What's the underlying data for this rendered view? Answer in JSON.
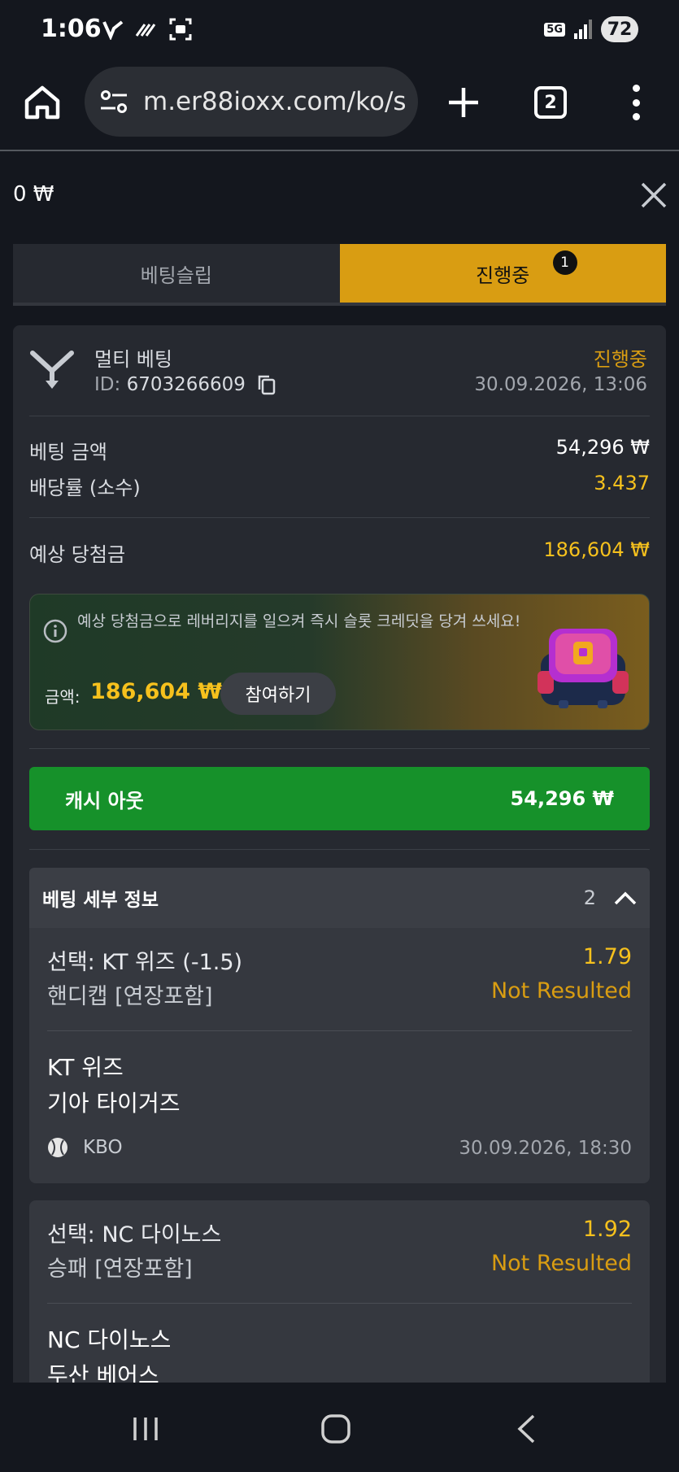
{
  "status_bar": {
    "time": "1:06",
    "network": "5G",
    "battery": "72"
  },
  "browser": {
    "url": "m.er88ioxx.com/ko/s",
    "tab_count": "2"
  },
  "balance": "0 ₩",
  "tabs": {
    "betslip": "베팅슬립",
    "ongoing": "진행중",
    "ongoing_badge": "1"
  },
  "bet": {
    "type": "멀티 베팅",
    "id_label": "ID:",
    "id": "6703266609",
    "status": "진행중",
    "date": "30.09.2026, 13:06",
    "stake_label": "베팅 금액",
    "stake": "54,296 ₩",
    "odds_label": "배당률 (소수)",
    "odds": "3.437",
    "payout_label": "예상 당첨금",
    "payout": "186,604 ₩"
  },
  "promo": {
    "text": "예상 당첨금으로 레버리지를 일으켜 즉시 슬롯 크레딧을 당겨 쓰세요!",
    "amount_label": "금액:",
    "amount": "186,604 ₩",
    "join_label": "참여하기"
  },
  "cashout": {
    "label": "캐시 아웃",
    "amount": "54,296 ₩"
  },
  "details": {
    "title": "베팅 세부 정보",
    "count": "2"
  },
  "selections": [
    {
      "pick": "선택: KT 위즈 (-1.5)",
      "odds": "1.79",
      "market": "핸디캡 [연장포함]",
      "status": "Not Resulted",
      "team1": "KT 위즈",
      "team2": "기아 타이거즈",
      "league": "KBO",
      "date": "30.09.2026, 18:30"
    },
    {
      "pick": "선택: NC 다이노스",
      "odds": "1.92",
      "market": "승패 [연장포함]",
      "status": "Not Resulted",
      "team1": "NC 다이노스",
      "team2": "두산 베어스"
    }
  ],
  "colors": {
    "accent_yellow": "#d99d12",
    "value_yellow": "#f6c11d",
    "cashout_green": "#16912a",
    "background": "#14171e",
    "card": "#262930"
  }
}
